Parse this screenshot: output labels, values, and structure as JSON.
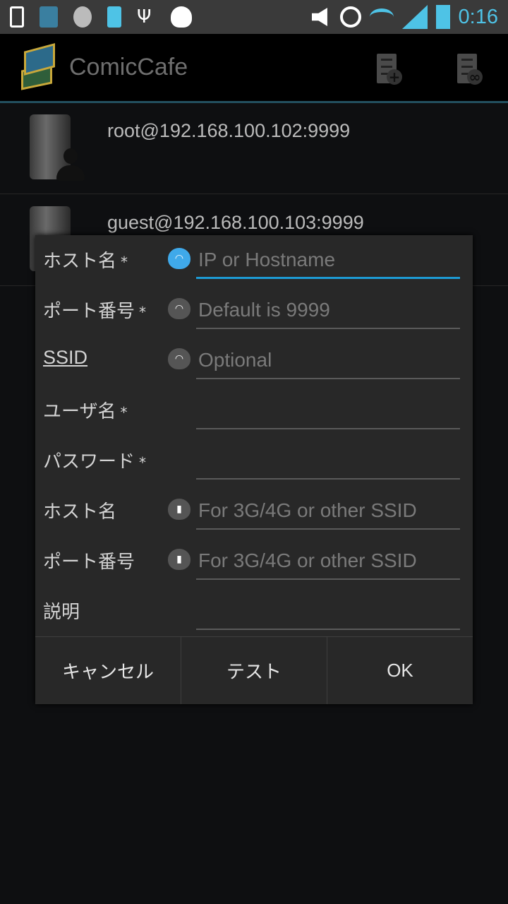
{
  "status_bar": {
    "time": "0:16",
    "icons": [
      "phone-icon",
      "comiccafe-notification-icon",
      "weather-10-percent-icon",
      "usb-battery-icon",
      "usb-icon",
      "debug-bug-icon",
      "muted-volume-icon",
      "alarm-icon",
      "wifi-icon",
      "signal-icon",
      "battery-charging-icon"
    ],
    "accent": "#4ec3e6"
  },
  "action_bar": {
    "title": "ComicCafe",
    "actions": [
      "add-server-icon",
      "search-server-icon"
    ]
  },
  "servers": [
    {
      "label": "root@192.168.100.102:9999"
    },
    {
      "label": "guest@192.168.100.103:9999"
    }
  ],
  "dialog": {
    "rows": [
      {
        "label": "ホスト名",
        "required": "*",
        "icon": "wifi-cloud-icon",
        "placeholder": "IP or Hostname",
        "value": ""
      },
      {
        "label": "ポート番号",
        "required": "*",
        "icon": "wifi-cloud-icon",
        "placeholder": "Default is 9999",
        "value": ""
      },
      {
        "label": "SSID",
        "required": "",
        "icon": "wifi-cloud-icon",
        "placeholder": "Optional",
        "value": ""
      },
      {
        "label": "ユーザ名",
        "required": "*",
        "icon": "",
        "placeholder": "",
        "value": ""
      },
      {
        "label": "パスワード",
        "required": "*",
        "icon": "",
        "placeholder": "",
        "value": ""
      },
      {
        "label": "ホスト名",
        "required": "",
        "icon": "mobile-signal-cloud-icon",
        "placeholder": "For 3G/4G or other SSID",
        "value": ""
      },
      {
        "label": "ポート番号",
        "required": "",
        "icon": "mobile-signal-cloud-icon",
        "placeholder": "For 3G/4G or other SSID",
        "value": ""
      },
      {
        "label": "説明",
        "required": "",
        "icon": "",
        "placeholder": "",
        "value": ""
      }
    ],
    "buttons": {
      "cancel": "キャンセル",
      "test": "テスト",
      "ok": "OK"
    },
    "focus_color": "#1d9ad3"
  }
}
